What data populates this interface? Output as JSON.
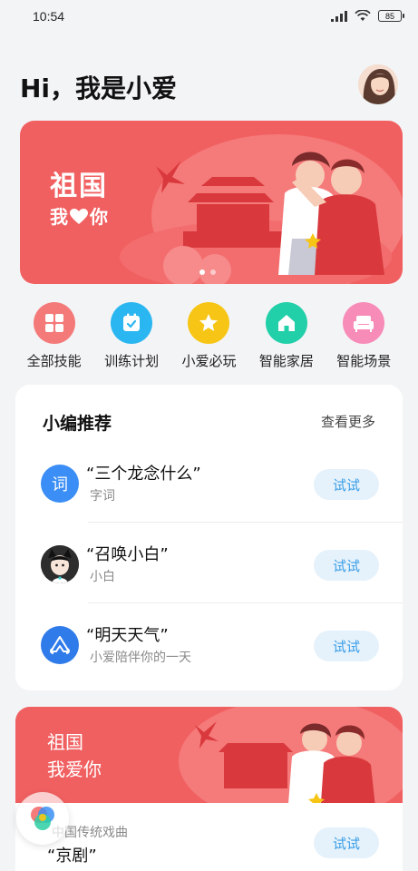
{
  "status": {
    "time": "10:54",
    "battery": "85"
  },
  "header": {
    "greeting": "Hi，我是小爱"
  },
  "banner": {
    "line1": "祖国",
    "line2_a": "我",
    "line2_b": "你"
  },
  "quick": [
    {
      "label": "全部技能",
      "icon": "grid-icon",
      "color": "#f47a7a"
    },
    {
      "label": "训练计划",
      "icon": "calendar-check-icon",
      "color": "#2ab6f0"
    },
    {
      "label": "小爱必玩",
      "icon": "star-icon",
      "color": "#f7c515"
    },
    {
      "label": "智能家居",
      "icon": "home-icon",
      "color": "#21cfa8"
    },
    {
      "label": "智能场景",
      "icon": "sofa-icon",
      "color": "#f78cb8"
    }
  ],
  "recommend": {
    "title": "小编推荐",
    "more": "查看更多",
    "items": [
      {
        "title": "“三个龙念什么”",
        "sub": "字词",
        "btn": "试试",
        "icon_text": "词"
      },
      {
        "title": "“召唤小白”",
        "sub": "小白",
        "btn": "试试"
      },
      {
        "title": "“明天天气”",
        "sub": "小爱陪伴你的一天",
        "btn": "试试"
      }
    ]
  },
  "banner2": {
    "line1": "祖国",
    "line2": "我爱你"
  },
  "bottom": {
    "sub": "中国传统戏曲",
    "title": "“京剧”",
    "btn": "试试"
  },
  "colors": {
    "banner_red": "#f16061",
    "try_blue": "#3a9ee8",
    "try_bg": "#e6f2fb"
  }
}
